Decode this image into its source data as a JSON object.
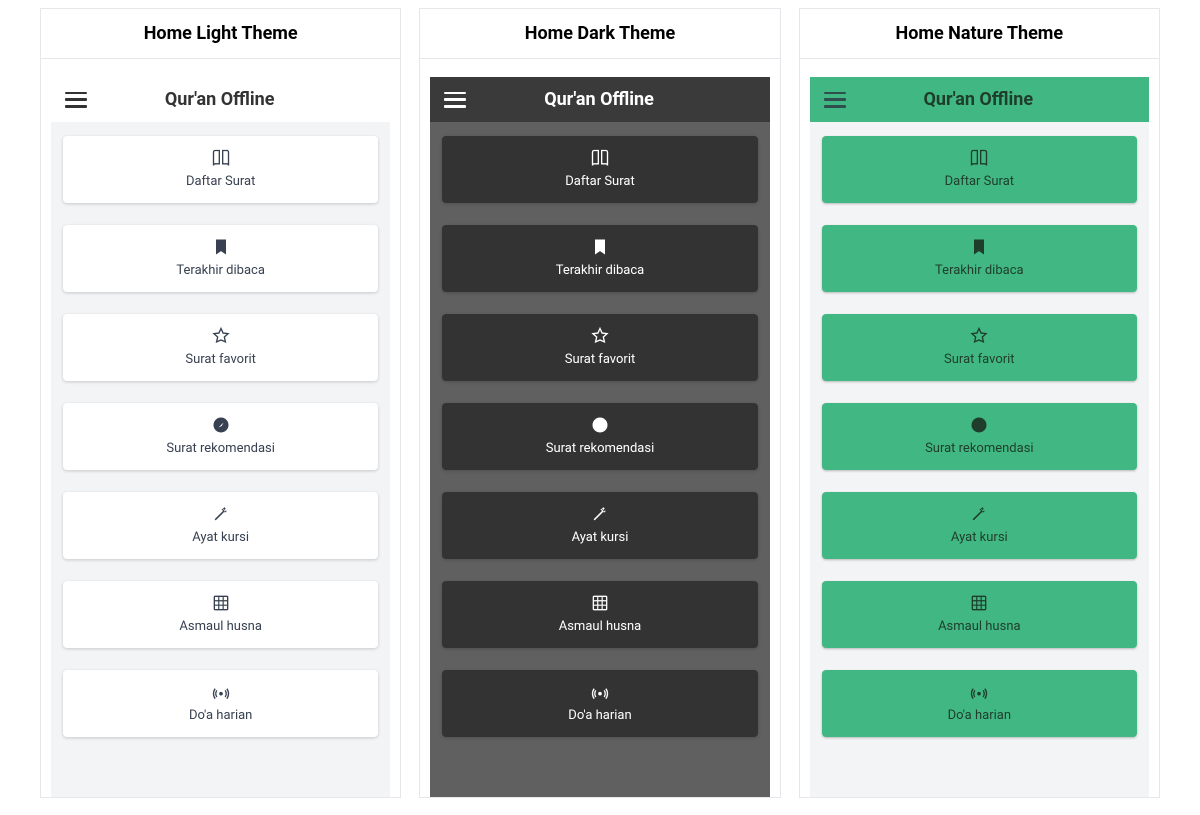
{
  "columns": [
    {
      "heading": "Home Light Theme",
      "theme": "light"
    },
    {
      "heading": "Home Dark Theme",
      "theme": "dark"
    },
    {
      "heading": "Home Nature Theme",
      "theme": "nature"
    }
  ],
  "app_title": "Qur'an Offline",
  "menu_items": [
    {
      "icon": "book",
      "label": "Daftar Surat"
    },
    {
      "icon": "bookmark",
      "label": "Terakhir dibaca"
    },
    {
      "icon": "star",
      "label": "Surat favorit"
    },
    {
      "icon": "compass",
      "label": "Surat rekomendasi"
    },
    {
      "icon": "wand",
      "label": "Ayat kursi"
    },
    {
      "icon": "grid",
      "label": "Asmaul husna"
    },
    {
      "icon": "radio",
      "label": "Do'a harian"
    }
  ],
  "colors": {
    "light_bg": "#ffffff",
    "light_panel": "#f3f4f6",
    "dark_appbar": "#3a3a3a",
    "dark_panel": "#606060",
    "dark_card": "#333333",
    "nature_accent": "#41b883"
  }
}
